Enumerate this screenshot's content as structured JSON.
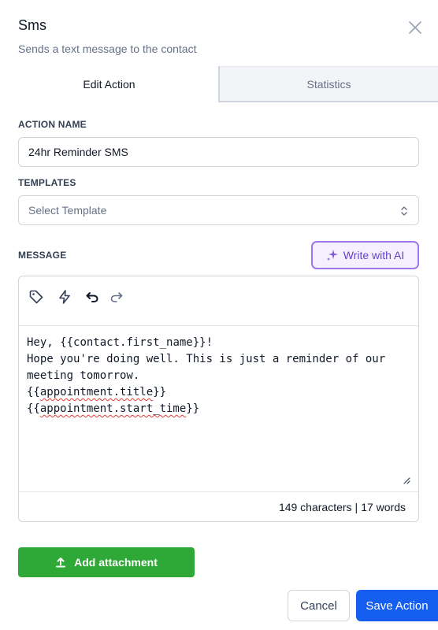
{
  "header": {
    "title": "Sms",
    "subtitle": "Sends a text message to the contact"
  },
  "tabs": [
    {
      "label": "Edit Action",
      "active": true
    },
    {
      "label": "Statistics",
      "active": false
    }
  ],
  "action_name": {
    "label": "ACTION NAME",
    "value": "24hr Reminder SMS"
  },
  "templates": {
    "label": "TEMPLATES",
    "placeholder": "Select Template"
  },
  "message": {
    "label": "MESSAGE",
    "ai_button_label": "Write with AI",
    "toolbar_icons": [
      "tag-icon",
      "bolt-icon",
      "undo-icon",
      "redo-icon"
    ],
    "line1_prefix": "Hey, ",
    "line1_var": "{{contact.first_name}}",
    "line1_suffix": "!",
    "line2": "Hope you're doing well. This is just a reminder of our meeting tomorrow.",
    "line3_open": "{{",
    "line3_var": "appointment.title",
    "line3_close": "}}",
    "line4_open": "{{",
    "line4_var": "appointment.start_time",
    "line4_close": "}}",
    "characters": "149 characters",
    "separator": "|",
    "words": "17 words"
  },
  "buttons": {
    "attachment": "Add attachment",
    "cancel": "Cancel",
    "save": "Save Action"
  },
  "colors": {
    "primary": "#155eef",
    "success": "#2ea836",
    "ai_border": "#9e77ed",
    "ai_text": "#6941c6"
  }
}
